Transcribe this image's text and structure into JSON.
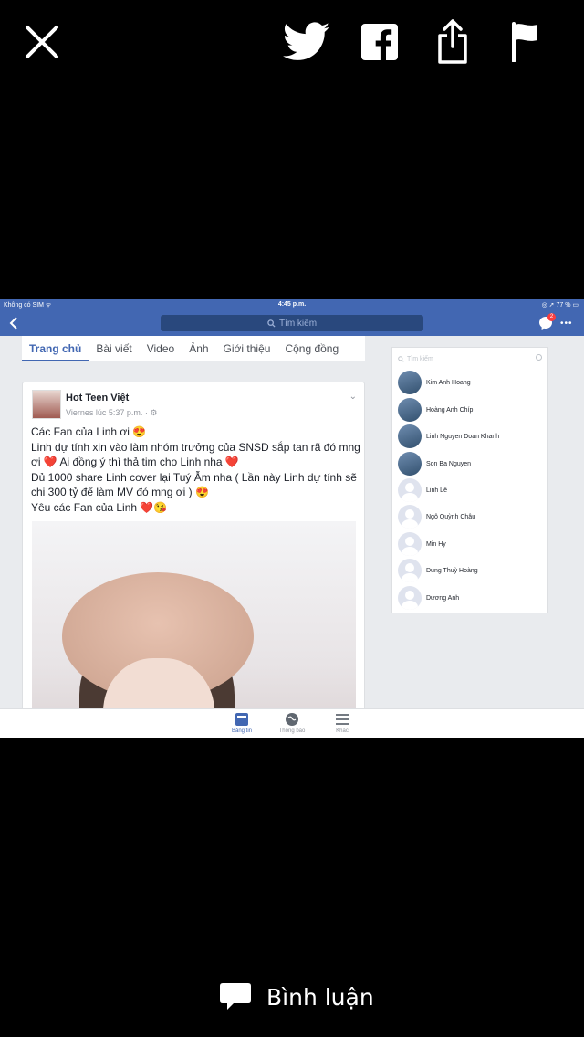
{
  "viewer": {
    "comment_label": "Bình luận"
  },
  "screenshot": {
    "status_left": "Không có SIM ᯤ",
    "status_time": "4:45 p.m.",
    "status_right": "◎ ➚ 77 % ▭",
    "search_placeholder": "Tìm kiếm",
    "messenger_badge": "2",
    "tabs": [
      "Trang chủ",
      "Bài viết",
      "Video",
      "Ảnh",
      "Giới thiệu",
      "Cộng đồng"
    ],
    "post": {
      "author": "Hot Teen Việt",
      "time": "Viernes lúc 5:37 p.m. · ⚙",
      "lines": [
        "Các Fan của Linh ơi 😍",
        "Linh dự tính xin vào làm nhóm trưởng của SNSD sắp tan rã đó mng",
        "ơi ❤️  Ai đồng ý thì thả tim cho Linh nha ❤️",
        "Đủ 1000 share Linh cover lại Tuý Ẫm nha ( Lần này Linh dự tính sẽ",
        "chi 300 tỷ để làm MV đó mng ơi ) 😍",
        "Yêu các Fan của Linh ❤️😘"
      ]
    },
    "contacts_search": "Tìm kiếm",
    "contacts": [
      "Kim Anh Hoang",
      "Hoàng Anh Chíp",
      "Linh Nguyen Doan Khanh",
      "Son Ba Nguyen",
      "Linh Lê",
      "Ngô Quỳnh Châu",
      "Min Hy",
      "Dung Thuỳ Hoàng",
      "Dương Anh"
    ],
    "bottom_tabs": [
      "Bảng tin",
      "Thông báo",
      "Khác"
    ]
  },
  "colors": {
    "fb_blue": "#4267b2",
    "background": "#000000"
  }
}
